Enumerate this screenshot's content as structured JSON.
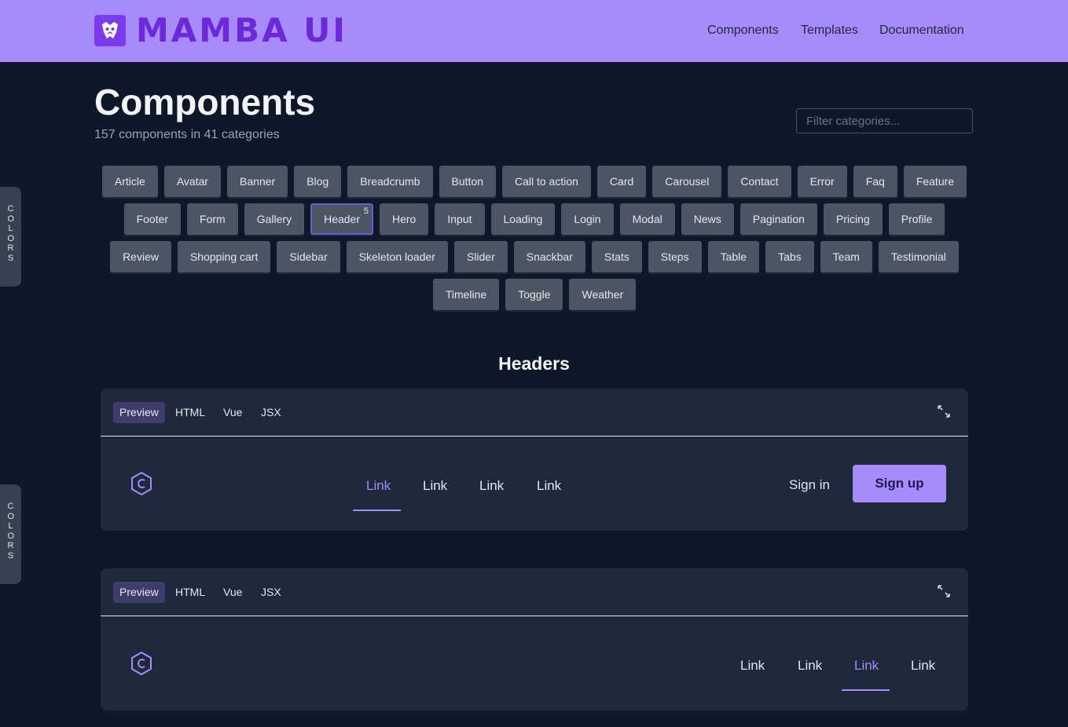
{
  "header": {
    "brand": "MAMBA UI",
    "nav": [
      "Components",
      "Templates",
      "Documentation"
    ]
  },
  "page": {
    "title": "Components",
    "subtitle": "157 components in 41 categories",
    "filter_placeholder": "Filter categories..."
  },
  "side_tabs": [
    "COLORS",
    "COLORS"
  ],
  "categories": [
    [
      "Article",
      "Avatar",
      "Banner",
      "Blog",
      "Breadcrumb",
      "Button",
      "Call to action",
      "Card",
      "Carousel",
      "Contact",
      "Error",
      "Faq",
      "Feature"
    ],
    [
      "Footer",
      "Form",
      "Gallery",
      "Header",
      "Hero",
      "Input",
      "Loading",
      "Login",
      "Modal",
      "News",
      "Pagination",
      "Pricing",
      "Profile"
    ],
    [
      "Review",
      "Shopping cart",
      "Sidebar",
      "Skeleton loader",
      "Slider",
      "Snackbar",
      "Stats",
      "Steps",
      "Table",
      "Tabs",
      "Team",
      "Testimonial"
    ],
    [
      "Timeline",
      "Toggle",
      "Weather"
    ]
  ],
  "active_category": {
    "label": "Header",
    "count": "5"
  },
  "section_title": "Headers",
  "preview_tabs": [
    "Preview",
    "HTML",
    "Vue",
    "JSX"
  ],
  "previews": [
    {
      "links": [
        "Link",
        "Link",
        "Link",
        "Link"
      ],
      "active_link_index": 0,
      "signin": "Sign in",
      "signup": "Sign up"
    },
    {
      "links": [
        "Link",
        "Link",
        "Link",
        "Link"
      ],
      "active_link_index": 2
    }
  ],
  "colors": {
    "accent": "#a78bfa",
    "background": "#0f172a",
    "card": "#1e293b",
    "chip": "#4b5563"
  }
}
